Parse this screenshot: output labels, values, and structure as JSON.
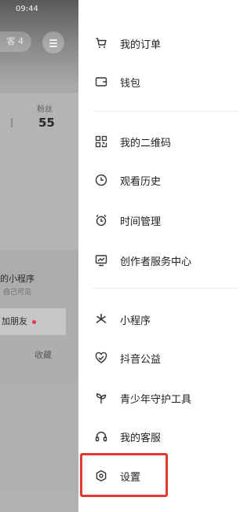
{
  "background": {
    "status_time": "09:44",
    "visitor_label": "客 4",
    "fans_label": "粉丝",
    "fans_count": "55",
    "mini_program_title": "的小程序",
    "mini_program_sub": "自己可见",
    "add_friend_label": "加朋友",
    "collect_label": "收藏"
  },
  "drawer": {
    "items": [
      {
        "label": "我的订单",
        "icon": "cart-icon"
      },
      {
        "label": "钱包",
        "icon": "wallet-icon"
      },
      {
        "label": "我的二维码",
        "icon": "qr-code-icon"
      },
      {
        "label": "观看历史",
        "icon": "clock-icon"
      },
      {
        "label": "时间管理",
        "icon": "alarm-clock-icon"
      },
      {
        "label": "创作者服务中心",
        "icon": "creator-chart-icon"
      },
      {
        "label": "小程序",
        "icon": "asterisk-icon"
      },
      {
        "label": "抖音公益",
        "icon": "heart-hands-icon"
      },
      {
        "label": "青少年守护工具",
        "icon": "sprout-icon"
      },
      {
        "label": "我的客服",
        "icon": "headset-icon"
      },
      {
        "label": "设置",
        "icon": "settings-icon"
      }
    ]
  },
  "colors": {
    "highlight": "#e23a2e",
    "notification_dot": "#e8344e"
  }
}
